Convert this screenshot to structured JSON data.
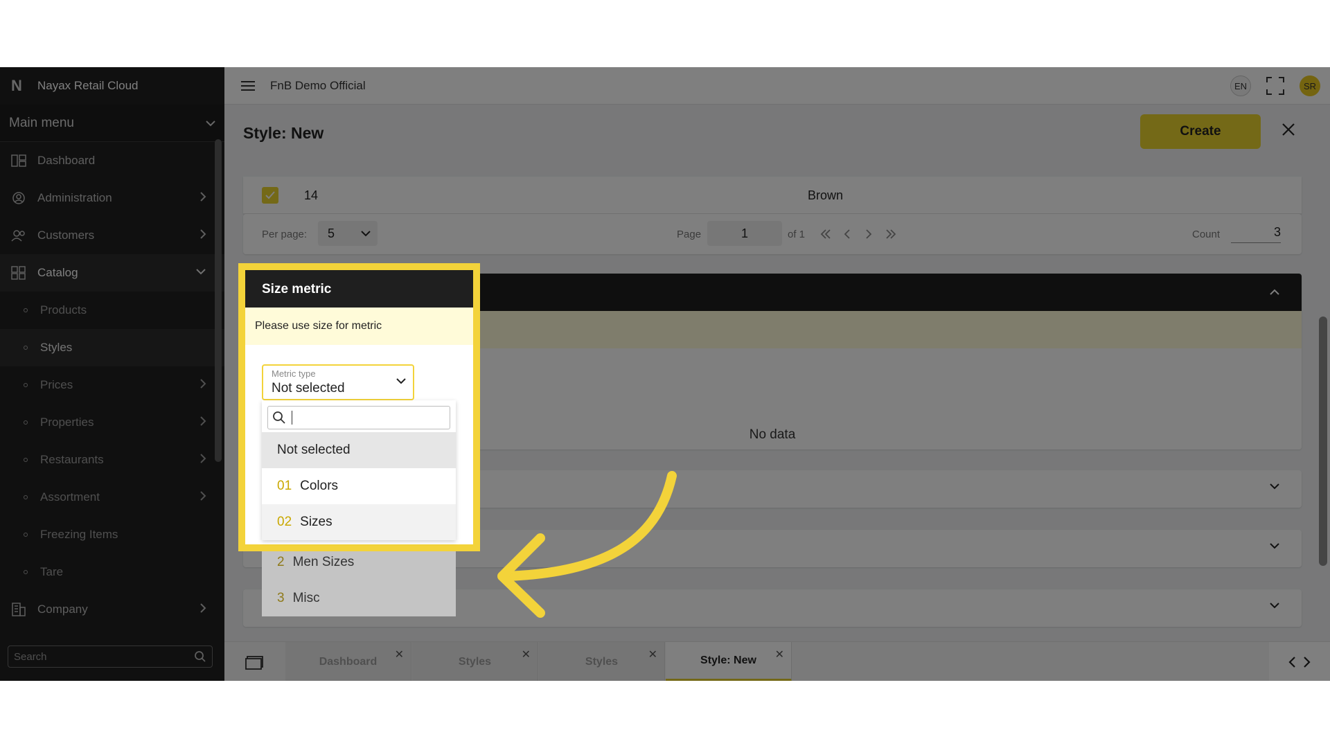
{
  "sidebar": {
    "brand": "Nayax Retail Cloud",
    "main_menu": "Main menu",
    "items": [
      {
        "label": "Dashboard",
        "icon": "dashboard-icon"
      },
      {
        "label": "Administration",
        "icon": "admin-gear-icon"
      },
      {
        "label": "Customers",
        "icon": "customers-icon"
      },
      {
        "label": "Catalog",
        "icon": "catalog-icon"
      }
    ],
    "catalog_sub": [
      "Products",
      "Styles",
      "Prices",
      "Properties",
      "Restaurants",
      "Assortment",
      "Freezing Items",
      "Tare"
    ],
    "company": "Company",
    "search_placeholder": "Search"
  },
  "topbar": {
    "company_name": "FnB Demo Official",
    "lang": "EN",
    "avatar": "SR"
  },
  "page": {
    "title": "Style: New",
    "create_label": "Create"
  },
  "table": {
    "row_id": "14",
    "row_value": "Brown",
    "per_page_label": "Per page:",
    "per_page_value": "5",
    "page_label": "Page",
    "page_value": "1",
    "of_label": "of 1",
    "count_label": "Count",
    "count_value": "3"
  },
  "metric_section": {
    "title": "Size metric",
    "info": "Please use size for metric",
    "no_data": "No data",
    "select_caption": "Metric type",
    "select_value": "Not selected",
    "options": [
      {
        "num": "",
        "label": "Not selected"
      },
      {
        "num": "01",
        "label": "Colors"
      },
      {
        "num": "02",
        "label": "Sizes"
      },
      {
        "num": "2",
        "label": "Men Sizes"
      },
      {
        "num": "3",
        "label": "Misc"
      }
    ]
  },
  "tabs": [
    {
      "label": "Dashboard"
    },
    {
      "label": "Styles"
    },
    {
      "label": "Styles"
    },
    {
      "label": "Style: New",
      "active": true
    }
  ],
  "colors": {
    "accent": "#e8d22e",
    "highlight": "#f3d33a",
    "sidebar": "#212121"
  }
}
